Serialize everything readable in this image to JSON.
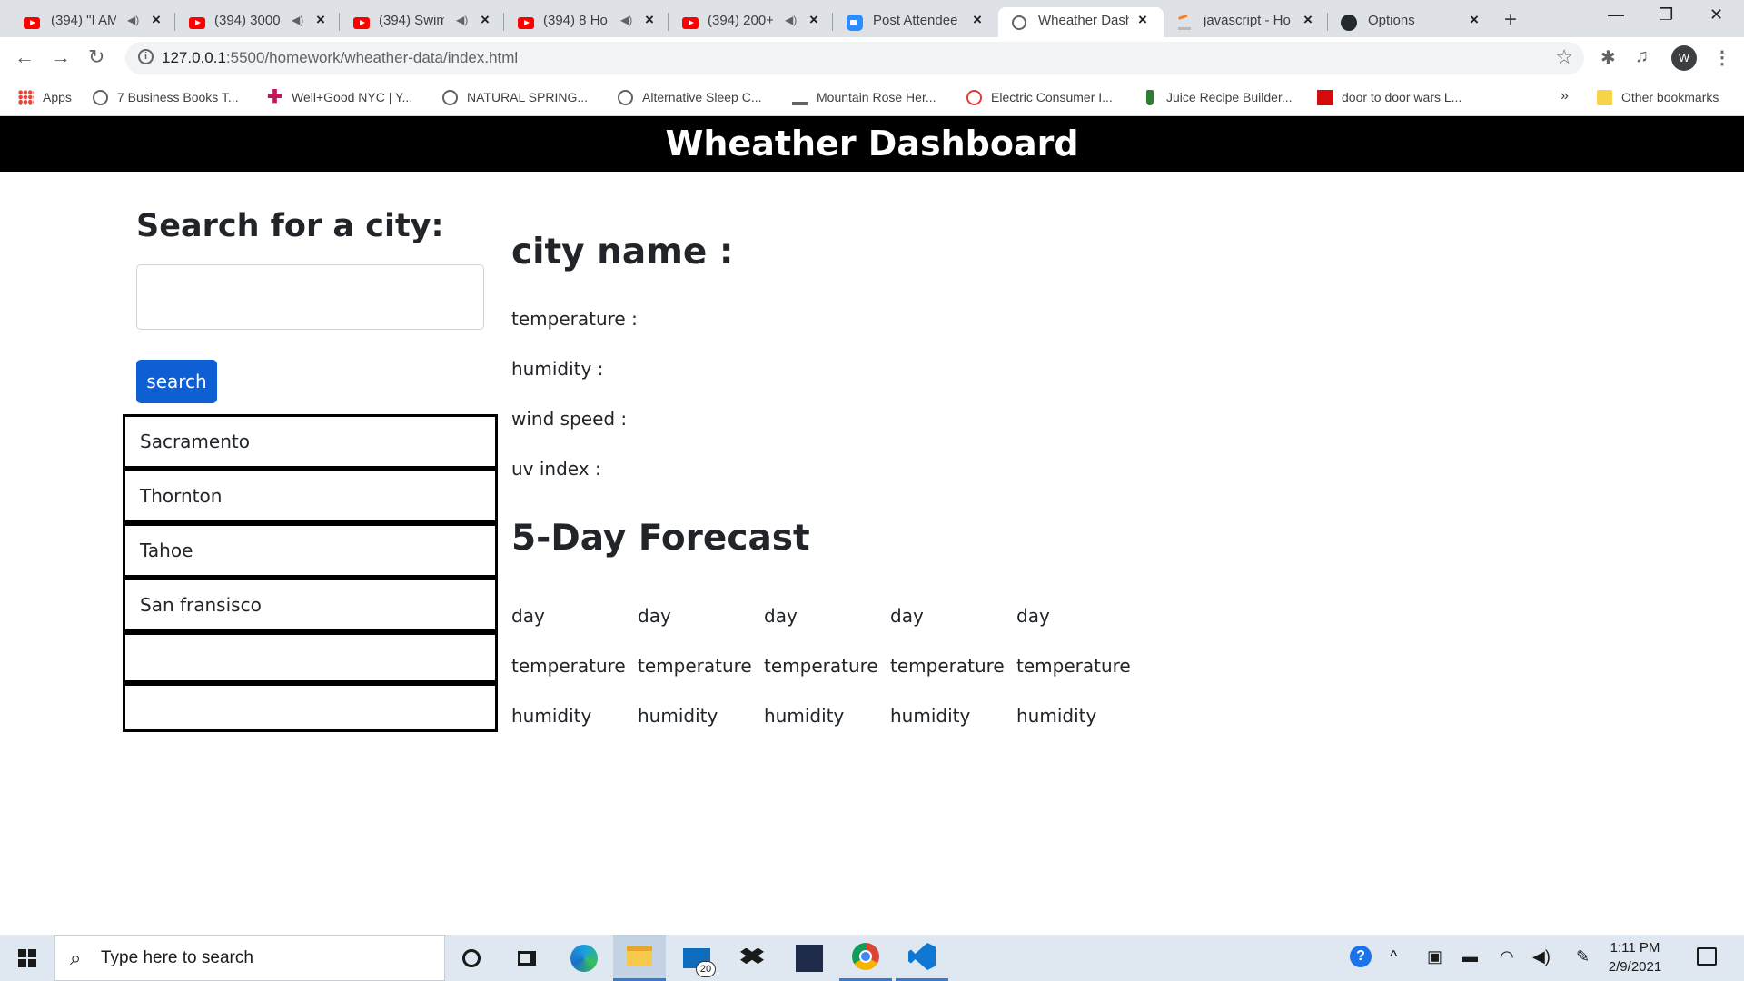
{
  "browser": {
    "tabs": [
      {
        "title": "(394) \"I AM",
        "icon": "youtube-icon"
      },
      {
        "title": "(394) 3000",
        "icon": "youtube-icon"
      },
      {
        "title": "(394) Swim",
        "icon": "youtube-icon"
      },
      {
        "title": "(394) 8 Ho",
        "icon": "youtube-icon"
      },
      {
        "title": "(394) 200+",
        "icon": "youtube-icon"
      },
      {
        "title": "Post Attendee",
        "icon": "zoom-icon"
      },
      {
        "title": "Wheather Dash",
        "icon": "globe-icon"
      },
      {
        "title": "javascript - Ho",
        "icon": "stackoverflow-icon"
      },
      {
        "title": "Options",
        "icon": "github-icon"
      }
    ],
    "url_host": "127.0.0.1",
    "url_path": ":5500/homework/wheather-data/index.html",
    "profile_initial": "W",
    "bookmarks": [
      {
        "label": "Apps",
        "icon": "apps-grid-icon"
      },
      {
        "label": "7 Business Books T...",
        "icon": "globe-icon"
      },
      {
        "label": "Well+Good NYC | Y...",
        "icon": "plus-icon"
      },
      {
        "label": "NATURAL SPRING...",
        "icon": "globe-icon"
      },
      {
        "label": "Alternative Sleep C...",
        "icon": "globe-icon"
      },
      {
        "label": "Mountain Rose Her...",
        "icon": "mountain-rose-icon"
      },
      {
        "label": "Electric Consumer I...",
        "icon": "circle-icon"
      },
      {
        "label": "Juice Recipe Builder...",
        "icon": "juice-icon"
      },
      {
        "label": "door to door wars L...",
        "icon": "espn-icon"
      }
    ],
    "bookmarks_more": "»",
    "other_bookmarks": "Other bookmarks"
  },
  "page": {
    "header_title": "Wheather Dashboard",
    "search_title": "Search for a city:",
    "search_input_value": "",
    "search_button_label": "search",
    "history": [
      "Sacramento",
      "Thornton",
      "Tahoe",
      "San fransisco",
      "",
      ""
    ],
    "city_name_label": "city name :",
    "stats": {
      "temperature": "temperature :",
      "humidity": "humidity :",
      "wind_speed": "wind speed :",
      "uv_index": "uv index :"
    },
    "forecast_title": "5-Day Forecast",
    "forecast": [
      {
        "day": "day",
        "temperature": "temperature",
        "humidity": "humidity"
      },
      {
        "day": "day",
        "temperature": "temperature",
        "humidity": "humidity"
      },
      {
        "day": "day",
        "temperature": "temperature",
        "humidity": "humidity"
      },
      {
        "day": "day",
        "temperature": "temperature",
        "humidity": "humidity"
      },
      {
        "day": "day",
        "temperature": "temperature",
        "humidity": "humidity"
      }
    ]
  },
  "taskbar": {
    "search_placeholder": "Type here to search",
    "mail_badge": "20",
    "time": "1:11 PM",
    "date": "2/9/2021"
  },
  "colors": {
    "header_bg": "#000000",
    "header_text": "#ffffff",
    "button_bg": "#0d5fd3",
    "history_border": "#000000"
  }
}
